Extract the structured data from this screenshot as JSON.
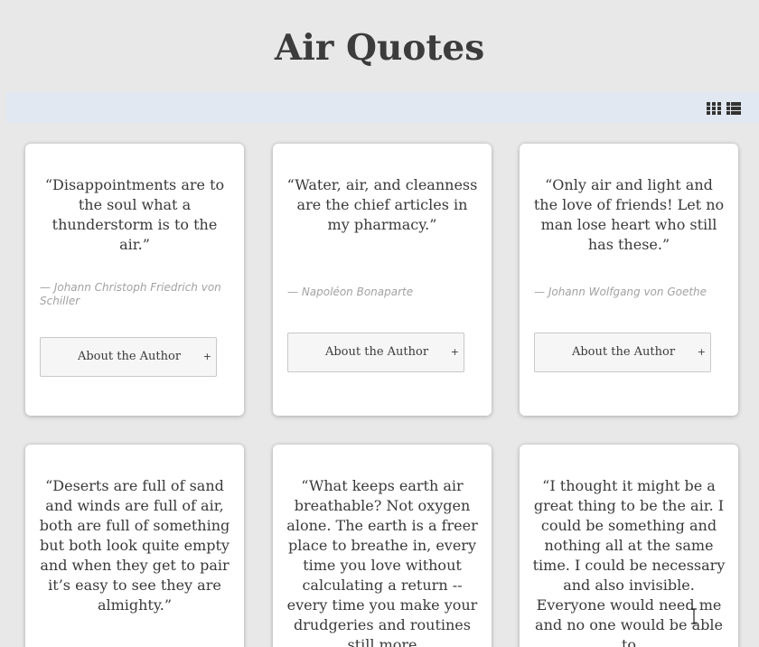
{
  "page": {
    "title": "Air Quotes"
  },
  "toolbar": {
    "grid_view_icon": "grid-icon",
    "list_view_icon": "list-icon"
  },
  "cards": [
    {
      "quote": "“Disappointments are to the soul what a thunderstorm is to the air.”",
      "author": "— Johann Christoph Friedrich von Schiller",
      "button_label": "About the Author",
      "button_plus": "+"
    },
    {
      "quote": "“Water, air, and cleanness are the chief articles in my pharmacy.”",
      "author": "— Napoléon Bonaparte",
      "button_label": "About the Author",
      "button_plus": "+"
    },
    {
      "quote": "“Only air and light and the love of friends! Let no man lose heart who still has these.”",
      "author": "— Johann Wolfgang von Goethe",
      "button_label": "About the Author",
      "button_plus": "+"
    },
    {
      "quote": "“Deserts are full of sand and winds are full of air, both are full of something but both look quite empty and when they get to pair it’s easy to see they are almighty.”"
    },
    {
      "quote": "“What keeps earth air breathable? Not oxygen alone. The earth is a freer place to breathe in, every time you love without calculating a return -- every time you make your drudgeries and routines still more"
    },
    {
      "quote": "“I thought it might be a great thing to be the air. I could be something and nothing all at the same time. I could be necessary and also invisible. Everyone would need me and no one would be able to"
    }
  ]
}
